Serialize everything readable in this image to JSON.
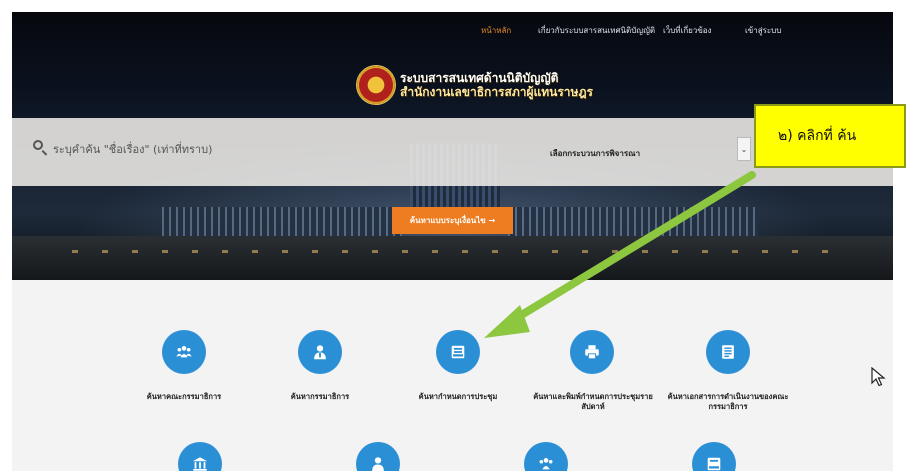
{
  "nav": {
    "items": [
      {
        "label": "หน้าหลัก",
        "active": true
      },
      {
        "label": "เกี่ยวกับระบบสารสนเทศนิติบัญญัติ",
        "active": false
      },
      {
        "label": "เว็บที่เกี่ยวข้อง",
        "active": false
      },
      {
        "label": "เข้าสู่ระบบ",
        "active": false
      }
    ]
  },
  "header": {
    "title_line1": "ระบบสารสนเทศด้านนิติบัญญัติ",
    "title_line2": "สำนักงานเลขาธิการสภาผู้แทนราษฎร",
    "logo_icon": "parliament-seal-icon"
  },
  "search": {
    "placeholder": "ระบุคำค้น \"ชื่อเรื่อง\" (เท่าที่ทราบ)",
    "value": "",
    "procedure_select": "เลือกกระบวนการพิจารณา",
    "advanced_button": "ค้นหาแบบระบุเงื่อนไข →"
  },
  "services": [
    {
      "label": "ค้นหาคณะกรรมาธิการ",
      "icon": "group-icon"
    },
    {
      "label": "ค้นหากรรมาธิการ",
      "icon": "person-icon"
    },
    {
      "label": "ค้นหากำหนดการประชุม",
      "icon": "inbox-icon"
    },
    {
      "label": "ค้นหาและพิมพ์กำหนดการประชุมรายสัปดาห์",
      "icon": "printer-icon"
    },
    {
      "label": "ค้นหาเอกสารการดำเนินงานของคณะกรรมาธิการ",
      "icon": "document-icon"
    },
    {
      "label": "",
      "icon": "institution-icon"
    },
    {
      "label": "",
      "icon": "person-icon"
    },
    {
      "label": "",
      "icon": "group-icon"
    },
    {
      "label": "",
      "icon": "inbox-icon"
    }
  ],
  "callout": {
    "text": "๒) คลิกที่ ค้น"
  },
  "colors": {
    "accent_orange": "#ee7c21",
    "icon_blue": "#2b8fd6",
    "callout_yellow": "#ffff00",
    "arrow_green": "#8dc63f"
  }
}
